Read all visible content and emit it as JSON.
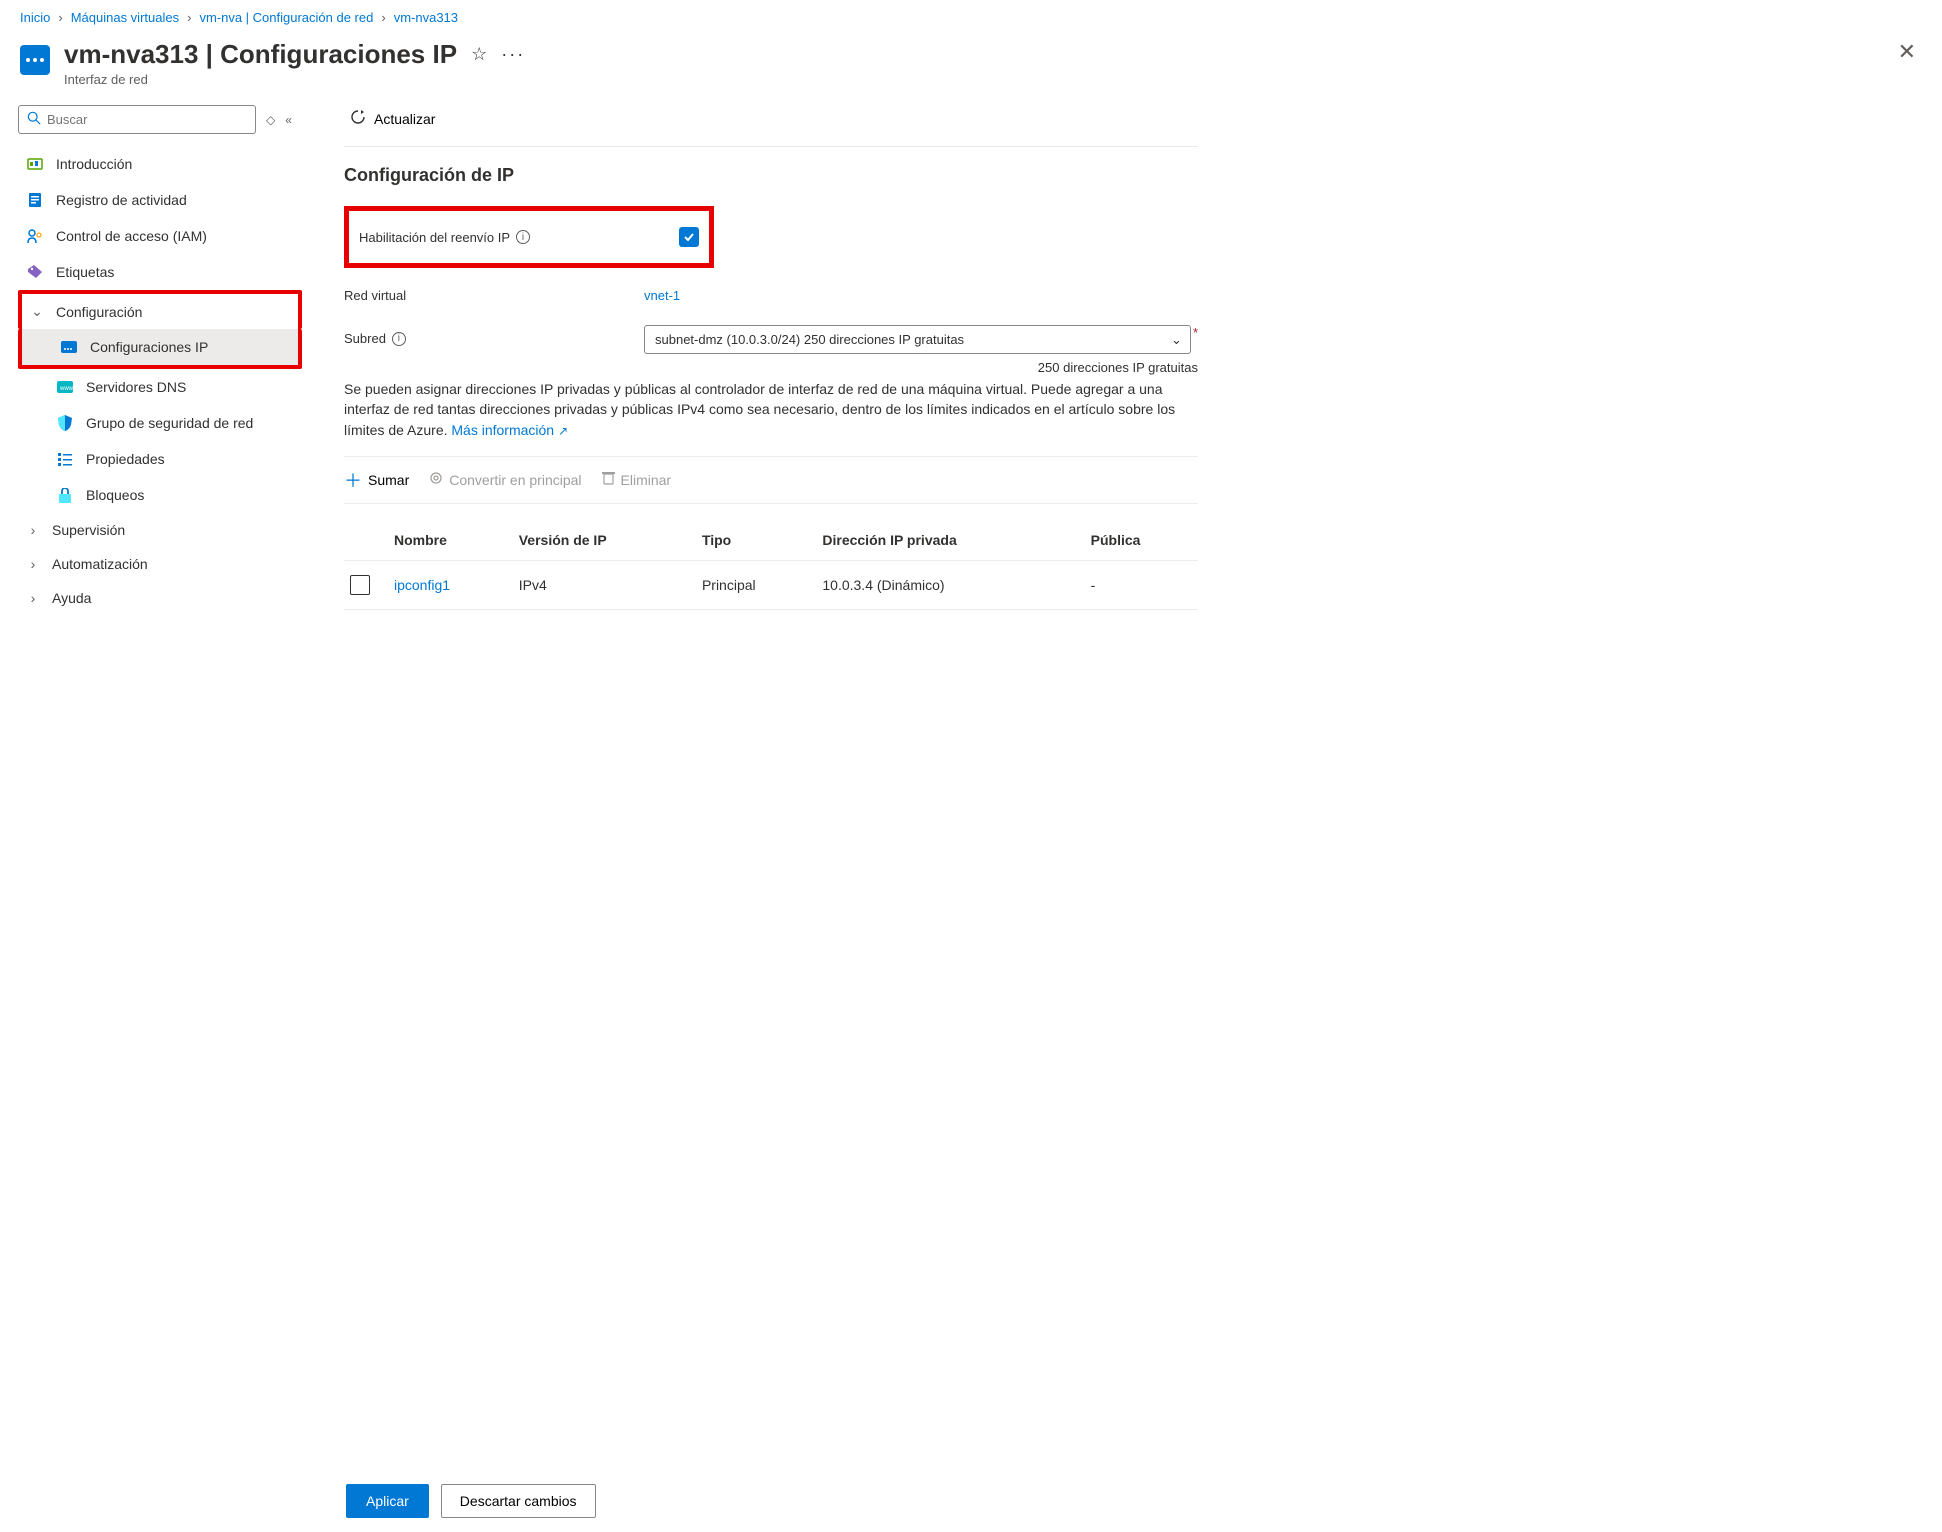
{
  "breadcrumb": {
    "items": [
      "Inicio",
      "Máquinas virtuales",
      "vm-nva | Configuración de red",
      "vm-nva313"
    ]
  },
  "header": {
    "title": "vm-nva313 | Configuraciones IP",
    "subtitle": "Interfaz de red"
  },
  "search": {
    "placeholder": "Buscar"
  },
  "sidebar": {
    "items": [
      {
        "label": "Introducción",
        "chev": false
      },
      {
        "label": "Registro de actividad",
        "chev": false
      },
      {
        "label": "Control de acceso (IAM)",
        "chev": false
      },
      {
        "label": "Etiquetas",
        "chev": false
      },
      {
        "label": "Configuración",
        "chev": true,
        "open": true
      },
      {
        "label": "Configuraciones IP",
        "child": true,
        "selected": true
      },
      {
        "label": "Servidores DNS",
        "child": true
      },
      {
        "label": "Grupo de seguridad de red",
        "child": true
      },
      {
        "label": "Propiedades",
        "child": true
      },
      {
        "label": "Bloqueos",
        "child": true
      },
      {
        "label": "Supervisión",
        "chev": true
      },
      {
        "label": "Automatización",
        "chev": true
      },
      {
        "label": "Ayuda",
        "chev": true
      }
    ]
  },
  "toolbar": {
    "refresh": "Actualizar"
  },
  "section": {
    "title": "Configuración de IP"
  },
  "form": {
    "ip_forward_label": "Habilitación del reenvío IP",
    "vnet_label": "Red virtual",
    "vnet_value": "vnet-1",
    "subnet_label": "Subred",
    "subnet_value": "subnet-dmz (10.0.3.0/24) 250 direcciones IP gratuitas",
    "subnet_helper": "250 direcciones IP gratuitas"
  },
  "paragraph": {
    "text": "Se pueden asignar direcciones IP privadas y públicas al controlador de interfaz de red de una máquina virtual. Puede agregar a una interfaz de red tantas direcciones privadas y públicas IPv4 como sea necesario, dentro de los límites indicados en el artículo sobre los límites de Azure.",
    "link": "Más información"
  },
  "actions": {
    "add": "Sumar",
    "primary": "Convertir en principal",
    "delete": "Eliminar"
  },
  "table": {
    "headers": {
      "name": "Nombre",
      "version": "Versión de IP",
      "type": "Tipo",
      "private": "Dirección IP privada",
      "public": "Pública"
    },
    "rows": [
      {
        "name": "ipconfig1",
        "version": "IPv4",
        "type": "Principal",
        "private": "10.0.3.4 (Dinámico)",
        "public": "-"
      }
    ]
  },
  "footer": {
    "apply": "Aplicar",
    "discard": "Descartar cambios"
  }
}
